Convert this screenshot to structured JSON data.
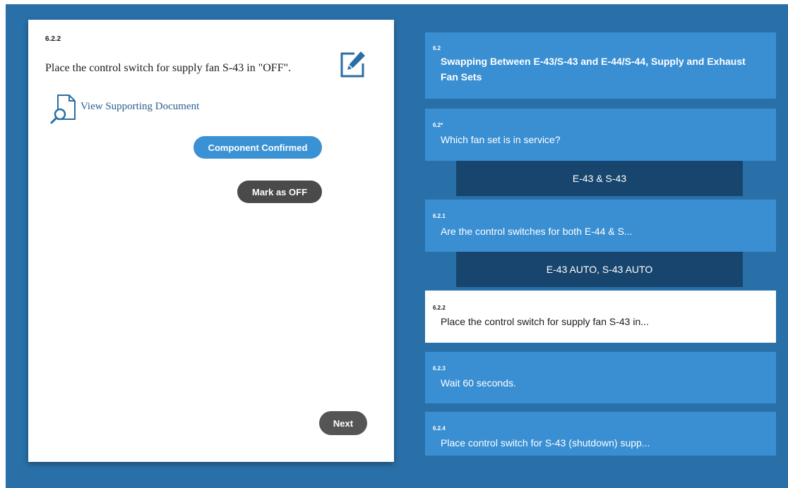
{
  "card": {
    "step_number": "6.2.2",
    "instruction": "Place the control switch for supply fan S-43 in \"OFF\".",
    "supporting_doc_label": "View Supporting Document",
    "component_confirmed_label": "Component Confirmed",
    "mark_off_label": "Mark as OFF",
    "next_label": "Next"
  },
  "steps": [
    {
      "number": "6.2",
      "title": "Swapping Between E-43/S-43 and E-44/S-44, Supply and Exhaust Fan Sets"
    },
    {
      "number": "6.2*",
      "text": "Which fan set is in service?",
      "answer": "E-43 & S-43"
    },
    {
      "number": "6.2.1",
      "text": "Are the control switches for both E-44 & S...",
      "answer": "E-43 AUTO, S-43 AUTO"
    },
    {
      "number": "6.2.2",
      "text": "Place the control switch for supply fan S-43 in..."
    },
    {
      "number": "6.2.3",
      "text": "Wait 60 seconds."
    },
    {
      "number": "6.2.4",
      "text": "Place control switch for S-43 (shutdown) supp..."
    }
  ],
  "colors": {
    "background": "#2970a9",
    "step_block": "#3a8fd3",
    "answer_bar": "#17456e",
    "active_step": "#ffffff",
    "primary_button": "#3a92d5",
    "dark_button": "#4a4a4a"
  },
  "icons": {
    "edit": "pencil-edit-icon",
    "document": "document-search-icon"
  },
  "active_step_index": 3
}
